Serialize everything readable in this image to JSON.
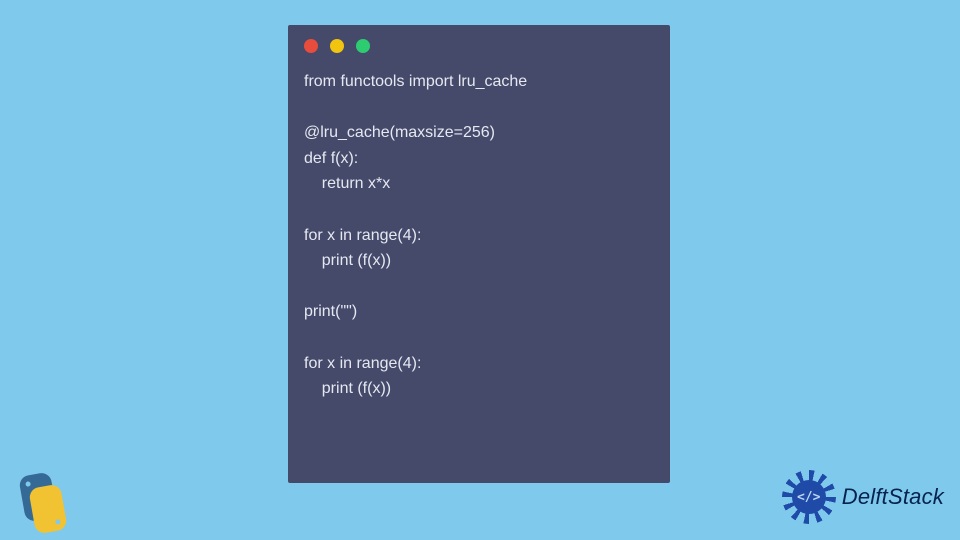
{
  "colors": {
    "background": "#7fcaec",
    "window_bg": "#454a6b",
    "code_fg": "#e6e8f0",
    "dot_red": "#e74c3c",
    "dot_yellow": "#f1c40f",
    "dot_green": "#2ecc71",
    "brand_blue": "#1f4aa8",
    "brand_text": "#06224e"
  },
  "code": {
    "lines": [
      "from functools import lru_cache",
      "",
      "@lru_cache(maxsize=256)",
      "def f(x):",
      "    return x*x",
      "",
      "for x in range(4):",
      "    print (f(x))",
      "",
      "print(\"\")",
      "",
      "for x in range(4):",
      "    print (f(x))"
    ]
  },
  "brand": {
    "name": "DelftStack",
    "badge_glyph": "</>"
  },
  "logos": {
    "bottom_left": "python-logo"
  }
}
